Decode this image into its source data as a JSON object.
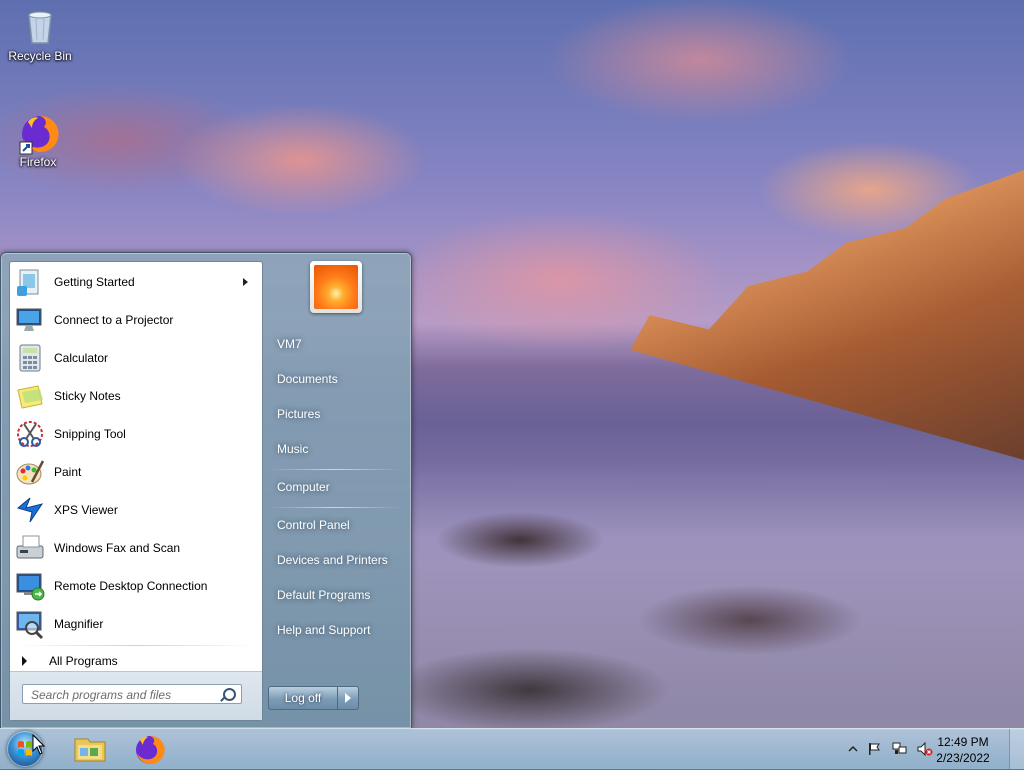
{
  "desktop": {
    "icons": [
      {
        "label": "Recycle Bin",
        "icon": "recycle-bin-icon"
      },
      {
        "label": "Firefox",
        "icon": "firefox-icon"
      }
    ]
  },
  "start_menu": {
    "programs": [
      {
        "label": "Getting Started",
        "icon": "getting-started-icon",
        "has_submenu": true
      },
      {
        "label": "Connect to a Projector",
        "icon": "projector-icon"
      },
      {
        "label": "Calculator",
        "icon": "calculator-icon"
      },
      {
        "label": "Sticky Notes",
        "icon": "sticky-notes-icon"
      },
      {
        "label": "Snipping Tool",
        "icon": "scissors-icon"
      },
      {
        "label": "Paint",
        "icon": "paint-palette-icon"
      },
      {
        "label": "XPS Viewer",
        "icon": "xps-viewer-icon"
      },
      {
        "label": "Windows Fax and Scan",
        "icon": "fax-icon"
      },
      {
        "label": "Remote Desktop Connection",
        "icon": "remote-desktop-icon"
      },
      {
        "label": "Magnifier",
        "icon": "magnifier-icon"
      }
    ],
    "all_programs_label": "All Programs",
    "search_placeholder": "Search programs and files",
    "right_links": {
      "user": "VM7",
      "documents": "Documents",
      "pictures": "Pictures",
      "music": "Music",
      "computer": "Computer",
      "control_panel": "Control Panel",
      "devices_printers": "Devices and Printers",
      "default_programs": "Default Programs",
      "help_support": "Help and Support"
    },
    "logoff_label": "Log off"
  },
  "taskbar": {
    "pinned": [
      "windows-explorer-icon",
      "firefox-icon"
    ],
    "tray": [
      "show-hidden-icons-chevron",
      "action-center-flag-icon",
      "network-icon",
      "volume-muted-icon"
    ],
    "clock": {
      "time": "12:49 PM",
      "date": "2/23/2022"
    }
  },
  "colors": {
    "accent": "#3a8ed0",
    "start_menu_glass": "#8ca5b9",
    "taskbar": "#a9c7df"
  }
}
